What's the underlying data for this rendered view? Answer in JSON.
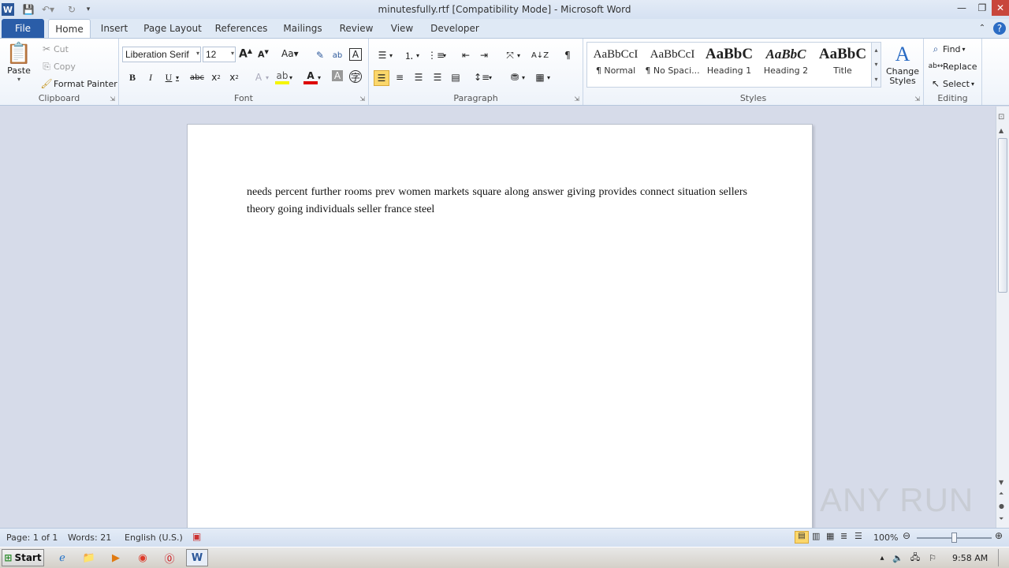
{
  "window": {
    "title": "minutesfully.rtf [Compatibility Mode] - Microsoft Word"
  },
  "tabs": [
    "File",
    "Home",
    "Insert",
    "Page Layout",
    "References",
    "Mailings",
    "Review",
    "View",
    "Developer"
  ],
  "clipboard": {
    "paste": "Paste",
    "cut": "Cut",
    "copy": "Copy",
    "format_painter": "Format Painter",
    "label": "Clipboard"
  },
  "font": {
    "name": "Liberation Serif",
    "size": "12",
    "label": "Font"
  },
  "paragraph": {
    "label": "Paragraph"
  },
  "styles": {
    "items": [
      {
        "sample": "AaBbCcI",
        "name": "¶ Normal"
      },
      {
        "sample": "AaBbCcI",
        "name": "¶ No Spaci..."
      },
      {
        "sample": "AaBbC",
        "name": "Heading 1"
      },
      {
        "sample": "AaBbC",
        "name": "Heading 2"
      },
      {
        "sample": "AaBbC",
        "name": "Title"
      }
    ],
    "change": "Change Styles",
    "label": "Styles"
  },
  "editing": {
    "find": "Find",
    "replace": "Replace",
    "select": "Select",
    "label": "Editing"
  },
  "document": {
    "text": "needs percent further rooms prev women   markets square along   answer giving provides connect situation   sellers theory going individuals   seller   france steel"
  },
  "status": {
    "page": "Page: 1 of 1",
    "words": "Words: 21",
    "language": "English (U.S.)",
    "zoom": "100%"
  },
  "taskbar": {
    "start": "Start",
    "time": "9:58 AM"
  },
  "watermark": "ANY RUN",
  "colors": {
    "file_tab": "#2a5da8",
    "accent": "#2b579a"
  }
}
